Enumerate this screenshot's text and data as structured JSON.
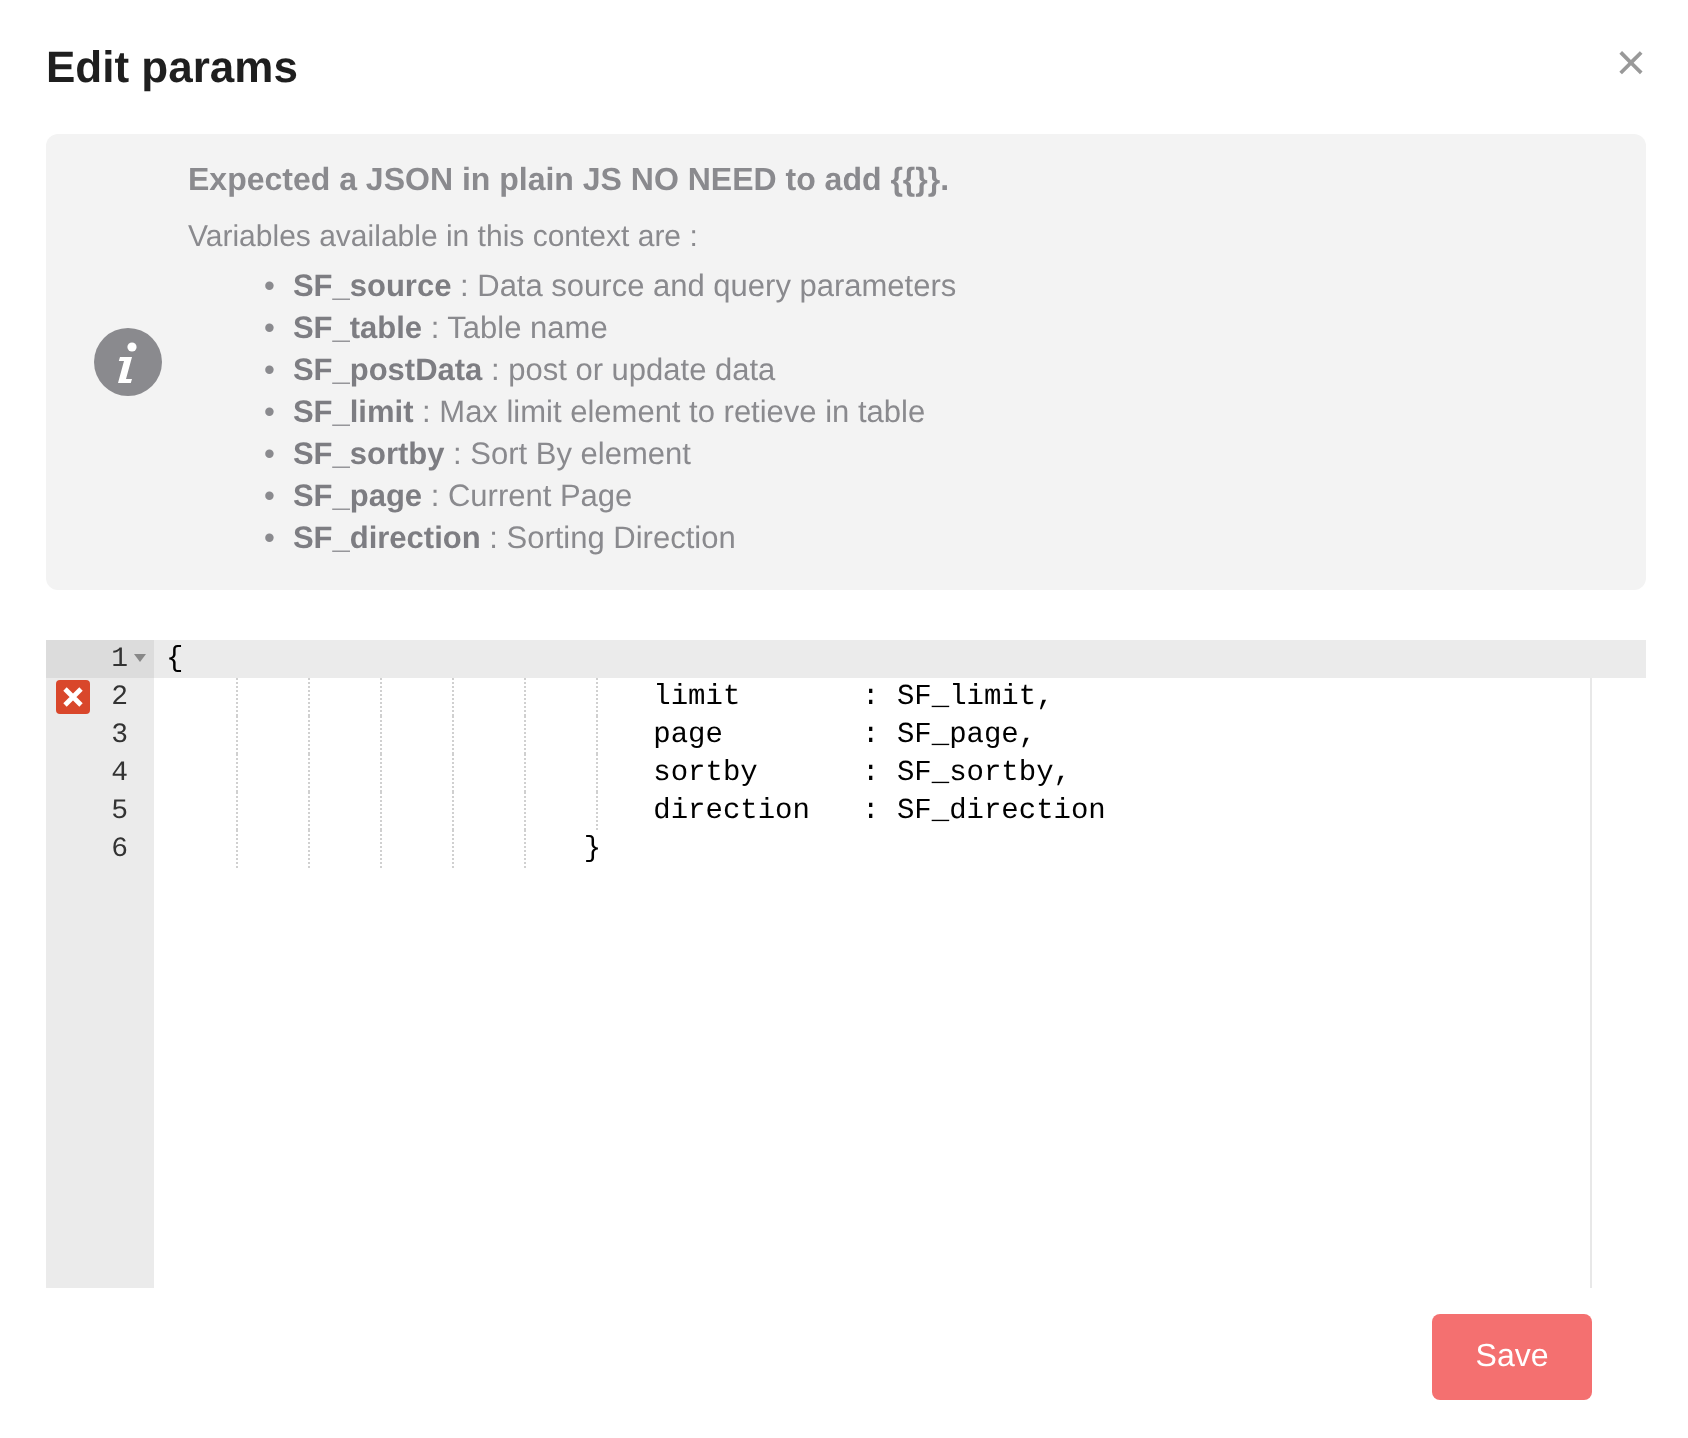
{
  "dialog": {
    "title": "Edit params",
    "close": "×"
  },
  "info": {
    "heading": "Expected a JSON in plain JS NO NEED to add {{}}.",
    "intro": "Variables available in this context are :",
    "variables": [
      {
        "bullet": "•",
        "name": "SF_source",
        "description": " : Data source and query parameters"
      },
      {
        "bullet": "•",
        "name": "SF_table",
        "description": " : Table name"
      },
      {
        "bullet": "•",
        "name": "SF_postData",
        "description": " : post or update data"
      },
      {
        "bullet": "•",
        "name": "SF_limit",
        "description": " : Max limit element to retieve in table"
      },
      {
        "bullet": "•",
        "name": "SF_sortby",
        "description": " : Sort By element"
      },
      {
        "bullet": "•",
        "name": "SF_page",
        "description": " : Current Page"
      },
      {
        "bullet": "•",
        "name": "SF_direction",
        "description": " : Sorting Direction"
      }
    ]
  },
  "editor": {
    "lines": [
      {
        "number": "1",
        "text": "{",
        "foldable": true,
        "error": false,
        "active": true
      },
      {
        "number": "2",
        "text": "                            limit       : SF_limit,",
        "foldable": false,
        "error": true,
        "active": false
      },
      {
        "number": "3",
        "text": "                            page        : SF_page,",
        "foldable": false,
        "error": false,
        "active": false
      },
      {
        "number": "4",
        "text": "                            sortby      : SF_sortby,",
        "foldable": false,
        "error": false,
        "active": false
      },
      {
        "number": "5",
        "text": "                            direction   : SF_direction",
        "foldable": false,
        "error": false,
        "active": false
      },
      {
        "number": "6",
        "text": "                        }",
        "foldable": false,
        "error": false,
        "active": false
      }
    ]
  },
  "buttons": [
    {
      "label": "Save"
    }
  ]
}
